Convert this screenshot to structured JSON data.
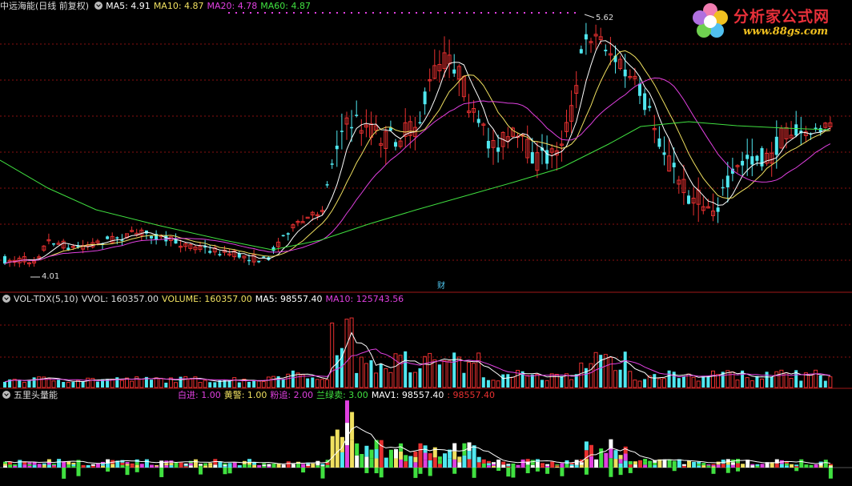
{
  "main": {
    "stock_name": "中远海能(日线 前复权)",
    "ma": [
      {
        "label": "MA5: 4.91",
        "color": "#ffffff"
      },
      {
        "label": "MA10: 4.87",
        "color": "#f0e060"
      },
      {
        "label": "MA20: 4.78",
        "color": "#e040e0"
      },
      {
        "label": "MA60: 4.87",
        "color": "#40e040"
      }
    ],
    "high_label": "5.62",
    "low_label": "4.01",
    "finance_marker": "财"
  },
  "volume": {
    "indicator": "VOL-TDX(5,10)",
    "values": [
      {
        "label": "VVOL: 160357.00",
        "color": "#dddddd"
      },
      {
        "label": "VOLUME: 160357.00",
        "color": "#f0e060"
      },
      {
        "label": "MA5: 98557.40",
        "color": "#ffffff"
      },
      {
        "label": "MA10: 125743.56",
        "color": "#e040e0"
      }
    ]
  },
  "wuli": {
    "indicator": "五里头量能",
    "values": [
      {
        "label": "白进: 1.00",
        "color": "#e040e0"
      },
      {
        "label": "黄警: 1.00",
        "color": "#f0e060"
      },
      {
        "label": "粉追: 2.00",
        "color": "#e040e0"
      },
      {
        "label": "兰绿卖: 3.00",
        "color": "#40e040"
      },
      {
        "label": "MAV1: 98557.40",
        "color": "#ffffff"
      },
      {
        "label": ": 98557.40",
        "color": "#e83030"
      }
    ]
  },
  "logo": {
    "title": "分析家公式网",
    "url": "www.88gs.com"
  },
  "colors": {
    "up": "#e83030",
    "down": "#50e8f0",
    "bg": "#000000"
  }
}
